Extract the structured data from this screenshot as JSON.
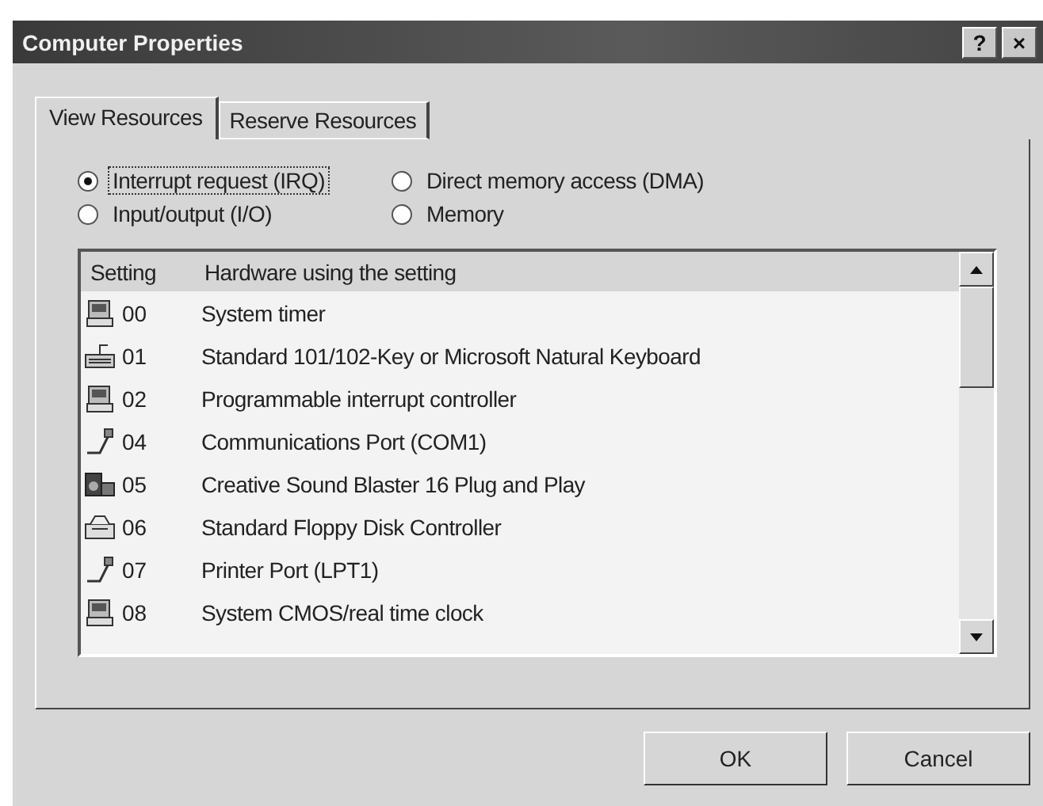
{
  "window": {
    "title": "Computer Properties",
    "title_buttons": [
      "?",
      "×"
    ]
  },
  "tabs": [
    {
      "label": "View Resources",
      "selected": true
    },
    {
      "label": "Reserve Resources",
      "selected": false
    }
  ],
  "radios": [
    {
      "label": "Interrupt request (IRQ)",
      "selected": true
    },
    {
      "label": "Direct memory access (DMA)",
      "selected": false
    },
    {
      "label": "Input/output (I/O)",
      "selected": false
    },
    {
      "label": "Memory",
      "selected": false
    }
  ],
  "list": {
    "columns": [
      "Setting",
      "Hardware using the setting"
    ],
    "rows": [
      {
        "kind": "chip",
        "setting": "00",
        "hardware": "System timer"
      },
      {
        "kind": "keyboard",
        "setting": "01",
        "hardware": "Standard 101/102-Key or Microsoft Natural Keyboard"
      },
      {
        "kind": "chip",
        "setting": "02",
        "hardware": "Programmable interrupt controller"
      },
      {
        "kind": "port",
        "setting": "04",
        "hardware": "Communications Port (COM1)"
      },
      {
        "kind": "sound",
        "setting": "05",
        "hardware": "Creative Sound Blaster 16 Plug and Play"
      },
      {
        "kind": "floppy",
        "setting": "06",
        "hardware": "Standard Floppy Disk Controller"
      },
      {
        "kind": "port",
        "setting": "07",
        "hardware": "Printer Port (LPT1)"
      },
      {
        "kind": "chip",
        "setting": "08",
        "hardware": "System CMOS/real time clock"
      }
    ]
  },
  "buttons": [
    "OK",
    "Cancel"
  ]
}
